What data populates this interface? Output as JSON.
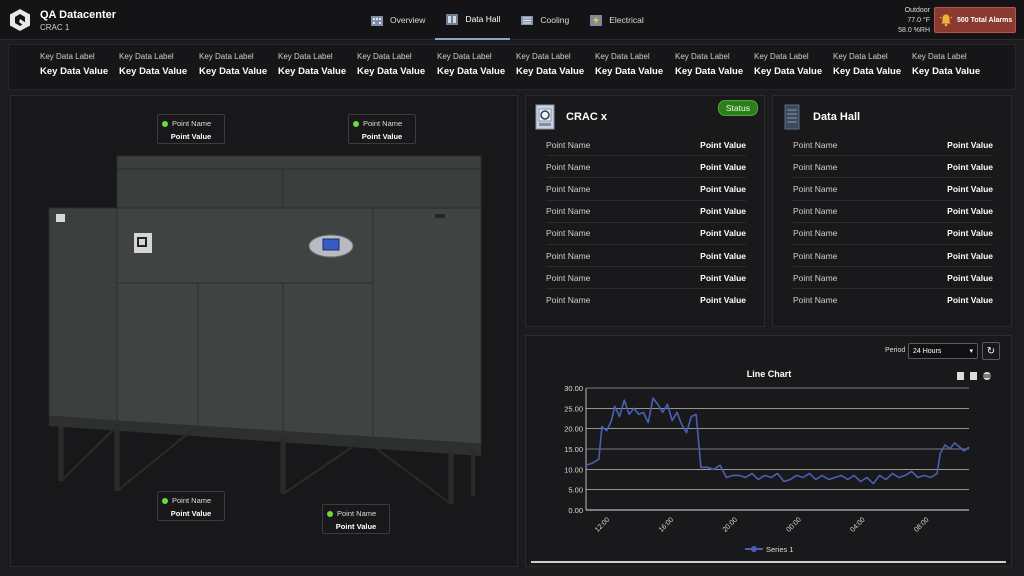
{
  "header": {
    "site_title": "QA Datacenter",
    "site_subtitle": "CRAC 1",
    "tabs": [
      {
        "label": "Overview",
        "icon": "building-icon",
        "active": false
      },
      {
        "label": "Data Hall",
        "icon": "server-icon",
        "active": true
      },
      {
        "label": "Cooling",
        "icon": "cooling-icon",
        "active": false
      },
      {
        "label": "Electrical",
        "icon": "electrical-icon",
        "active": false
      }
    ],
    "weather": {
      "label": "Outdoor",
      "temperature": "77.0 °F",
      "humidity": "58.0 %RH"
    },
    "alarm_label": "500 Total Alarms"
  },
  "kpis": [
    {
      "label": "Key Data Label",
      "value": "Key Data Value"
    },
    {
      "label": "Key Data Label",
      "value": "Key Data Value"
    },
    {
      "label": "Key Data Label",
      "value": "Key Data Value"
    },
    {
      "label": "Key Data Label",
      "value": "Key Data Value"
    },
    {
      "label": "Key Data Label",
      "value": "Key Data Value"
    },
    {
      "label": "Key Data Label",
      "value": "Key Data Value"
    },
    {
      "label": "Key Data Label",
      "value": "Key Data Value"
    },
    {
      "label": "Key Data Label",
      "value": "Key Data Value"
    },
    {
      "label": "Key Data Label",
      "value": "Key Data Value"
    },
    {
      "label": "Key Data Label",
      "value": "Key Data Value"
    },
    {
      "label": "Key Data Label",
      "value": "Key Data Value"
    },
    {
      "label": "Key Data Label",
      "value": "Key Data Value"
    }
  ],
  "callouts": [
    {
      "name": "Point Name",
      "value": "Point Value"
    },
    {
      "name": "Point Name",
      "value": "Point Value"
    },
    {
      "name": "Point Name",
      "value": "Point Value"
    },
    {
      "name": "Point Name",
      "value": "Point Value"
    }
  ],
  "crac_card": {
    "title": "CRAC x",
    "status": "Status",
    "rows": [
      {
        "name": "Point Name",
        "value": "Point Value"
      },
      {
        "name": "Point Name",
        "value": "Point Value"
      },
      {
        "name": "Point Name",
        "value": "Point Value"
      },
      {
        "name": "Point Name",
        "value": "Point Value"
      },
      {
        "name": "Point Name",
        "value": "Point Value"
      },
      {
        "name": "Point Name",
        "value": "Point Value"
      },
      {
        "name": "Point Name",
        "value": "Point Value"
      },
      {
        "name": "Point Name",
        "value": "Point Value"
      }
    ]
  },
  "hall_card": {
    "title": "Data Hall",
    "rows": [
      {
        "name": "Point Name",
        "value": "Point Value"
      },
      {
        "name": "Point Name",
        "value": "Point Value"
      },
      {
        "name": "Point Name",
        "value": "Point Value"
      },
      {
        "name": "Point Name",
        "value": "Point Value"
      },
      {
        "name": "Point Name",
        "value": "Point Value"
      },
      {
        "name": "Point Name",
        "value": "Point Value"
      },
      {
        "name": "Point Name",
        "value": "Point Value"
      },
      {
        "name": "Point Name",
        "value": "Point Value"
      }
    ]
  },
  "chart_controls": {
    "period_label": "Period",
    "period_value": "24 Hours"
  },
  "colors": {
    "accent": "#8aa4c8",
    "series": "#4a5fb5",
    "status_ok": "#2e7d1c",
    "alarm": "#8b3a30",
    "point_ok": "#6bdc3a"
  },
  "chart_data": {
    "type": "line",
    "title": "Line Chart",
    "xlabel": "",
    "ylabel": "",
    "ylim": [
      0,
      30
    ],
    "yticks": [
      "0.00",
      "5.00",
      "10.00",
      "15.00",
      "20.00",
      "25.00",
      "30.00"
    ],
    "xticks": [
      {
        "label": "12:00",
        "hour": 1.5
      },
      {
        "label": "16:00",
        "hour": 5.5
      },
      {
        "label": "20:00",
        "hour": 9.5
      },
      {
        "label": "00:00",
        "hour": 13.5
      },
      {
        "label": "04:00",
        "hour": 17.5
      },
      {
        "label": "08:00",
        "hour": 21.5
      }
    ],
    "x_range_hours": [
      0,
      24
    ],
    "grid": true,
    "legend": "bottom",
    "series": [
      {
        "name": "Series 1",
        "points": [
          [
            0,
            11
          ],
          [
            0.4,
            11.5
          ],
          [
            0.8,
            12.5
          ],
          [
            1.0,
            20.5
          ],
          [
            1.3,
            19.5
          ],
          [
            1.6,
            22
          ],
          [
            1.8,
            25.5
          ],
          [
            2.1,
            23
          ],
          [
            2.4,
            27
          ],
          [
            2.7,
            23.5
          ],
          [
            3.0,
            25
          ],
          [
            3.3,
            23.5
          ],
          [
            3.6,
            24
          ],
          [
            3.9,
            21.5
          ],
          [
            4.2,
            27.5
          ],
          [
            4.5,
            26
          ],
          [
            4.8,
            24
          ],
          [
            5.1,
            26
          ],
          [
            5.4,
            22
          ],
          [
            5.7,
            24
          ],
          [
            6.0,
            21
          ],
          [
            6.3,
            19
          ],
          [
            6.6,
            23
          ],
          [
            6.9,
            23.5
          ],
          [
            7.2,
            10.5
          ],
          [
            7.6,
            10.5
          ],
          [
            8.0,
            10
          ],
          [
            8.4,
            11
          ],
          [
            8.8,
            8
          ],
          [
            9.2,
            8.5
          ],
          [
            9.6,
            8.5
          ],
          [
            10.0,
            8
          ],
          [
            10.4,
            9
          ],
          [
            10.8,
            7.5
          ],
          [
            11.2,
            8.5
          ],
          [
            11.6,
            8
          ],
          [
            12.0,
            9
          ],
          [
            12.4,
            7
          ],
          [
            12.8,
            7.5
          ],
          [
            13.2,
            8.5
          ],
          [
            13.6,
            8
          ],
          [
            14.0,
            9
          ],
          [
            14.4,
            7.5
          ],
          [
            14.8,
            8.5
          ],
          [
            15.2,
            7.5
          ],
          [
            15.6,
            8
          ],
          [
            16.0,
            8.5
          ],
          [
            16.4,
            7.5
          ],
          [
            16.8,
            8.5
          ],
          [
            17.2,
            7
          ],
          [
            17.6,
            8
          ],
          [
            18.0,
            6.5
          ],
          [
            18.4,
            8.5
          ],
          [
            18.8,
            7.5
          ],
          [
            19.2,
            9
          ],
          [
            19.6,
            8
          ],
          [
            20.0,
            8.5
          ],
          [
            20.4,
            9.5
          ],
          [
            20.8,
            8
          ],
          [
            21.2,
            8.5
          ],
          [
            21.6,
            8
          ],
          [
            22.0,
            9
          ],
          [
            22.2,
            14
          ],
          [
            22.5,
            16
          ],
          [
            22.8,
            15
          ],
          [
            23.1,
            16.5
          ],
          [
            23.4,
            15.5
          ],
          [
            23.7,
            14.5
          ],
          [
            24.0,
            15.5
          ]
        ]
      }
    ]
  }
}
